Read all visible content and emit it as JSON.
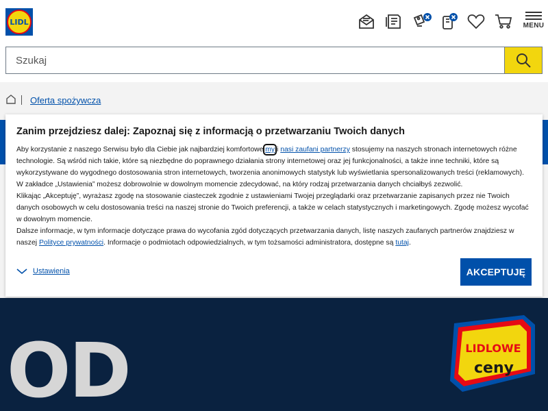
{
  "header": {
    "logo_text": "LIDL",
    "menu_label": "MENU",
    "icons": [
      "newsletter-icon",
      "leaflet-icon",
      "lidl-plus-coupons-icon",
      "lidl-plus-app-icon",
      "wishlist-icon",
      "cart-icon"
    ]
  },
  "search": {
    "placeholder": "Szukaj"
  },
  "breadcrumb": {
    "link": "Oferta spożywcza"
  },
  "banner": {
    "big_text": "OD",
    "badge_line1": "LIDLOWE",
    "badge_line2": "ceny"
  },
  "cookie_modal": {
    "title": "Zanim przejdziesz dalej: Zapoznaj się z informacją o przetwarzaniu Twoich danych",
    "p1_a": "Aby korzystanie z naszego Serwisu było dla Ciebie jak najbardziej komfortowe ",
    "p1_my": "my",
    "p1_i": " i ",
    "p1_partners": "nasi zaufani partnerzy",
    "p1_b": " stosujemy na naszych stronach internetowych różne technologie. Są wśród nich takie, które są niezbędne do poprawnego działania strony internetowej oraz jej funkcjonalności, a także inne techniki, które są wykorzystywane do wygodnego dostosowania stron internetowych, tworzenia anonimowych statystyk lub wyświetlania spersonalizowanych treści (reklamowych).",
    "p2": "W zakładce „Ustawienia” możesz dobrowolnie w dowolnym momencie zdecydować, na który rodzaj przetwarzania danych chciałbyś zezwolić.",
    "p3": "Klikając „Akceptuję”, wyrażasz zgodę na stosowanie ciasteczek zgodnie z ustawieniami Twojej przeglądarki oraz przetwarzanie zapisanych przez nie Twoich danych osobowych w celu dostosowania treści na naszej stronie do Twoich preferencji, a także w celach statystycznych i marketingowych. Zgodę możesz wycofać w dowolnym momencie.",
    "p4_a": "Dalsze informacje, w tym informacje dotyczące prawa do wycofania zgód dotyczących przetwarzania danych, listę naszych zaufanych partnerów znajdziesz w naszej ",
    "p4_privacy": "Polityce prywatności",
    "p4_b": ". Informacje o podmiotach odpowiedzialnych, w tym tożsamości administratora, dostępne są ",
    "p4_here": "tutaj",
    "p4_c": ".",
    "settings_label": "Ustawienia",
    "accept_label": "AKCEPTUJĘ"
  },
  "colors": {
    "brand_blue": "#0050aa",
    "brand_yellow": "#f2d60e",
    "brand_red": "#e60a14",
    "dark_navy": "#0a2240"
  }
}
